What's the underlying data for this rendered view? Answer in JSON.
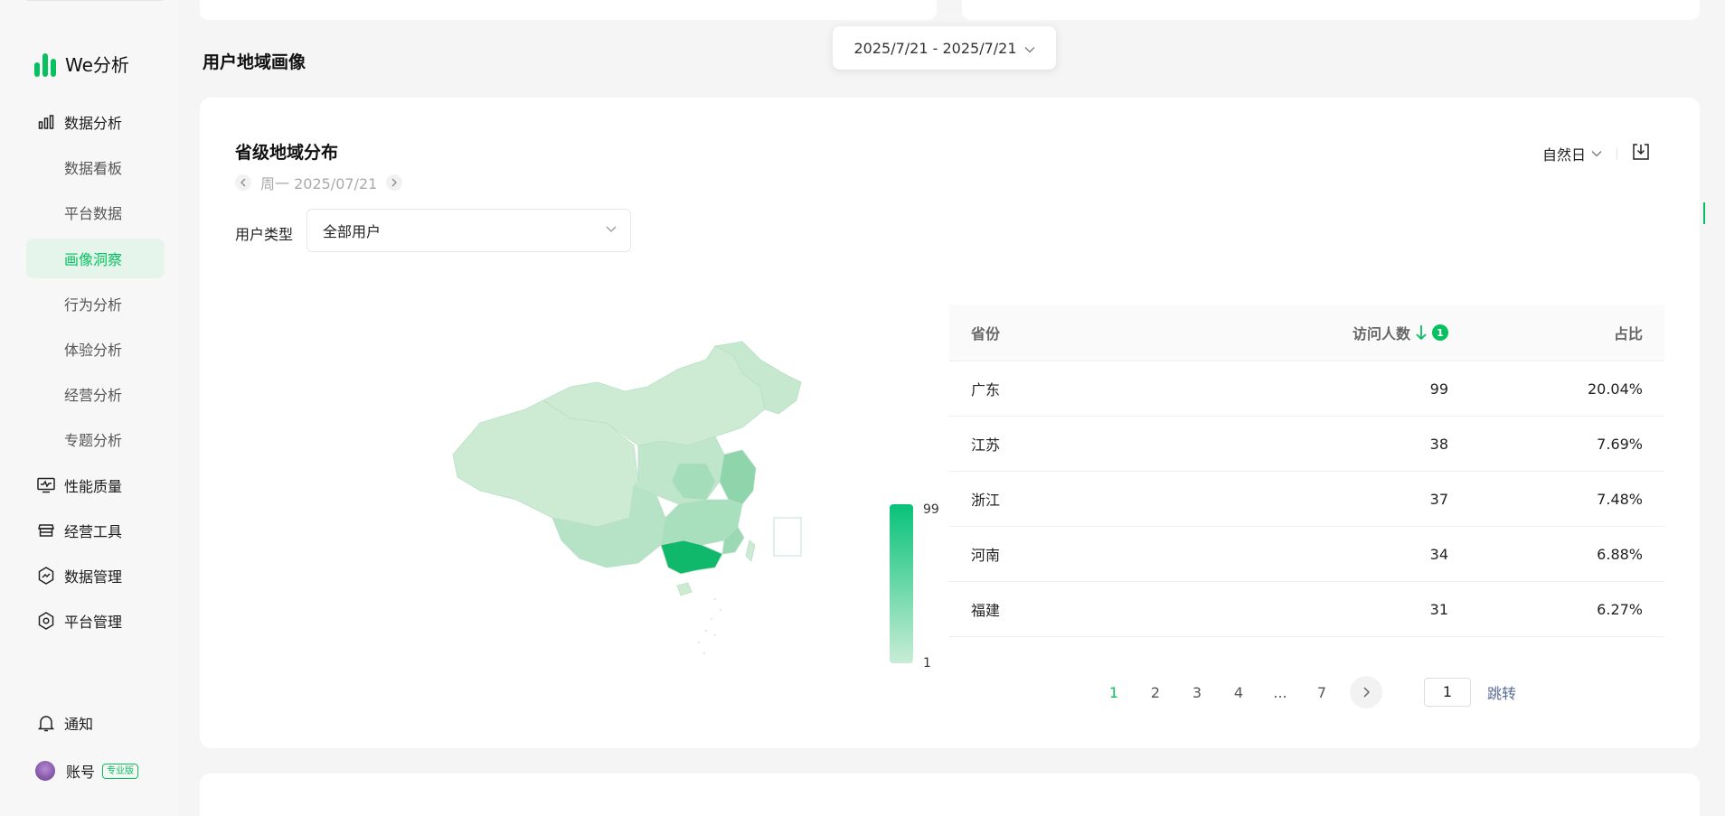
{
  "app": {
    "logo_text": "We分析",
    "brand_color": "#07c160"
  },
  "sidebar": {
    "items": [
      {
        "label": "数据分析",
        "type": "top",
        "icon": "bar-chart-icon"
      },
      {
        "label": "数据看板",
        "type": "sub"
      },
      {
        "label": "平台数据",
        "type": "sub"
      },
      {
        "label": "画像洞察",
        "type": "sub",
        "active": true
      },
      {
        "label": "行为分析",
        "type": "sub"
      },
      {
        "label": "体验分析",
        "type": "sub"
      },
      {
        "label": "经营分析",
        "type": "sub"
      },
      {
        "label": "专题分析",
        "type": "sub"
      },
      {
        "label": "性能质量",
        "type": "top",
        "icon": "monitor-pulse-icon"
      },
      {
        "label": "经营工具",
        "type": "top",
        "icon": "store-icon"
      },
      {
        "label": "数据管理",
        "type": "top",
        "icon": "hexagon-chart-icon"
      },
      {
        "label": "平台管理",
        "type": "top",
        "icon": "hexagon-gear-icon"
      }
    ],
    "notify_label": "通知",
    "account_label": "账号",
    "pro_badge": "专业版"
  },
  "header": {
    "date_range": "2025/7/21 - 2025/7/21"
  },
  "section": {
    "title": "用户地域画像"
  },
  "card": {
    "title": "省级地域分布",
    "date_label": "周一 2025/07/21",
    "period_select": "自然日",
    "filter_label": "用户类型",
    "filter_value": "全部用户"
  },
  "legend": {
    "max": "99",
    "min": "1"
  },
  "table": {
    "headers": {
      "province": "省份",
      "visitors": "访问人数",
      "sort_order": "1",
      "ratio": "占比"
    },
    "rows": [
      {
        "province": "广东",
        "visitors": "99",
        "ratio": "20.04%"
      },
      {
        "province": "江苏",
        "visitors": "38",
        "ratio": "7.69%"
      },
      {
        "province": "浙江",
        "visitors": "37",
        "ratio": "7.48%"
      },
      {
        "province": "河南",
        "visitors": "34",
        "ratio": "6.88%"
      },
      {
        "province": "福建",
        "visitors": "31",
        "ratio": "6.27%"
      }
    ]
  },
  "pagination": {
    "pages": [
      "1",
      "2",
      "3",
      "4",
      "...",
      "7"
    ],
    "current": "1",
    "jump_value": "1",
    "jump_label": "跳转"
  }
}
